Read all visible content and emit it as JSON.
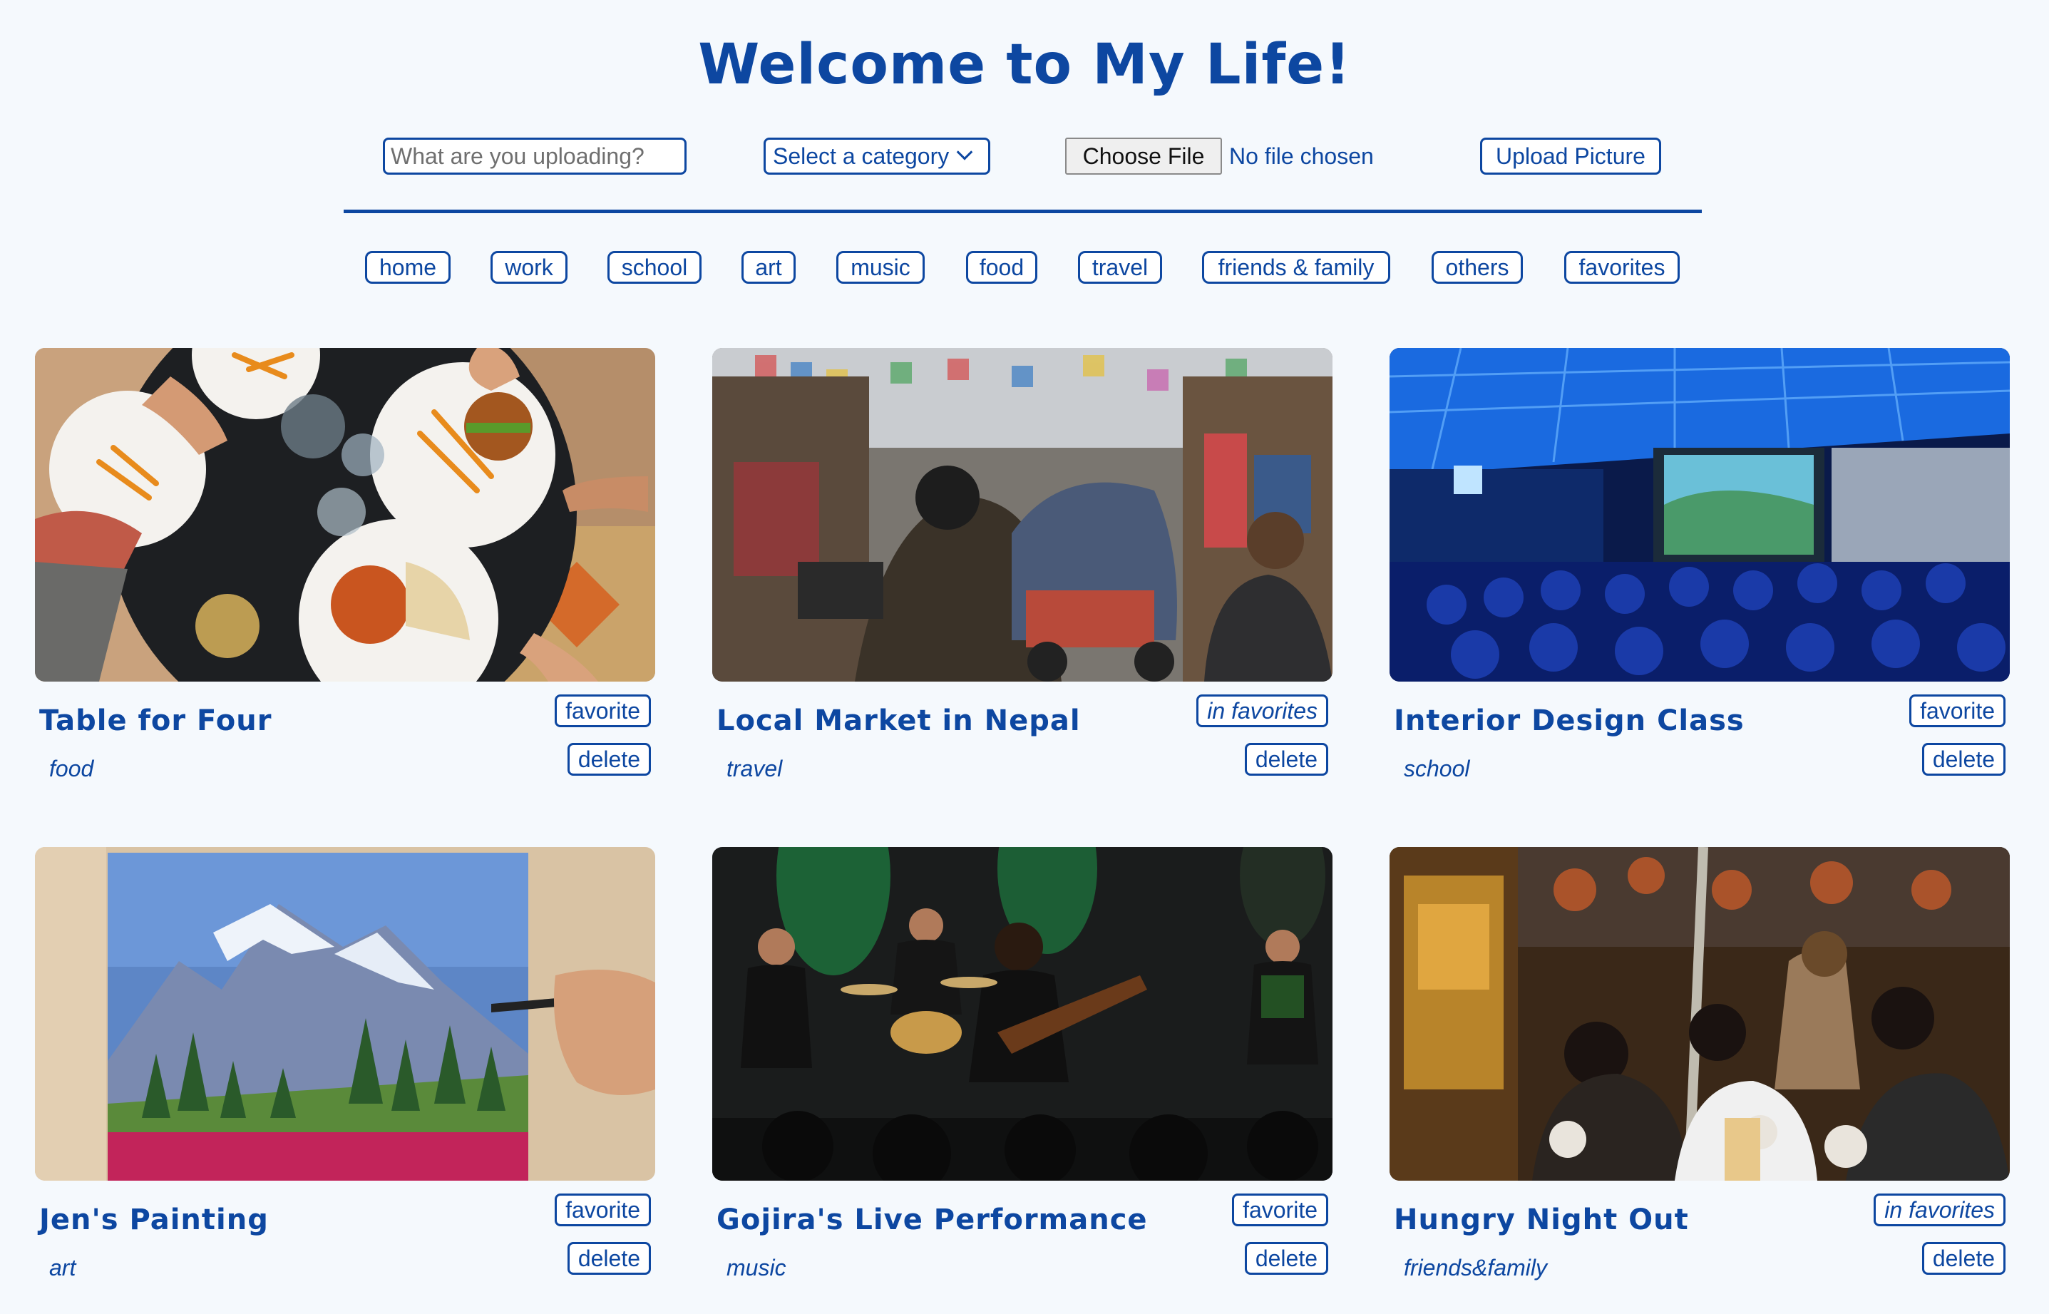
{
  "header": {
    "title": "Welcome to My Life!"
  },
  "upload": {
    "caption_placeholder": "What are you uploading?",
    "category_select": "Select a category",
    "choose_file_label": "Choose File",
    "file_status": "No file chosen",
    "upload_button": "Upload Picture"
  },
  "nav": {
    "items": [
      "home",
      "work",
      "school",
      "art",
      "music",
      "food",
      "travel",
      "friends & family",
      "others",
      "favorites"
    ]
  },
  "cards": [
    {
      "title": "Table for Four",
      "category": "food",
      "favorite_label": "favorite",
      "delete_label": "delete",
      "is_favorite": false
    },
    {
      "title": "Local Market in Nepal",
      "category": "travel",
      "favorite_label": "in favorites",
      "delete_label": "delete",
      "is_favorite": true
    },
    {
      "title": "Interior Design Class",
      "category": "school",
      "favorite_label": "favorite",
      "delete_label": "delete",
      "is_favorite": false
    },
    {
      "title": "Jen's Painting",
      "category": "art",
      "favorite_label": "favorite",
      "delete_label": "delete",
      "is_favorite": false
    },
    {
      "title": "Gojira's Live Performance",
      "category": "music",
      "favorite_label": "favorite",
      "delete_label": "delete",
      "is_favorite": false
    },
    {
      "title": "Hungry Night Out",
      "category": "friends&family",
      "favorite_label": "in favorites",
      "delete_label": "delete",
      "is_favorite": true
    }
  ],
  "colors": {
    "accent": "#0d47a1",
    "background": "#f5f9fd"
  }
}
